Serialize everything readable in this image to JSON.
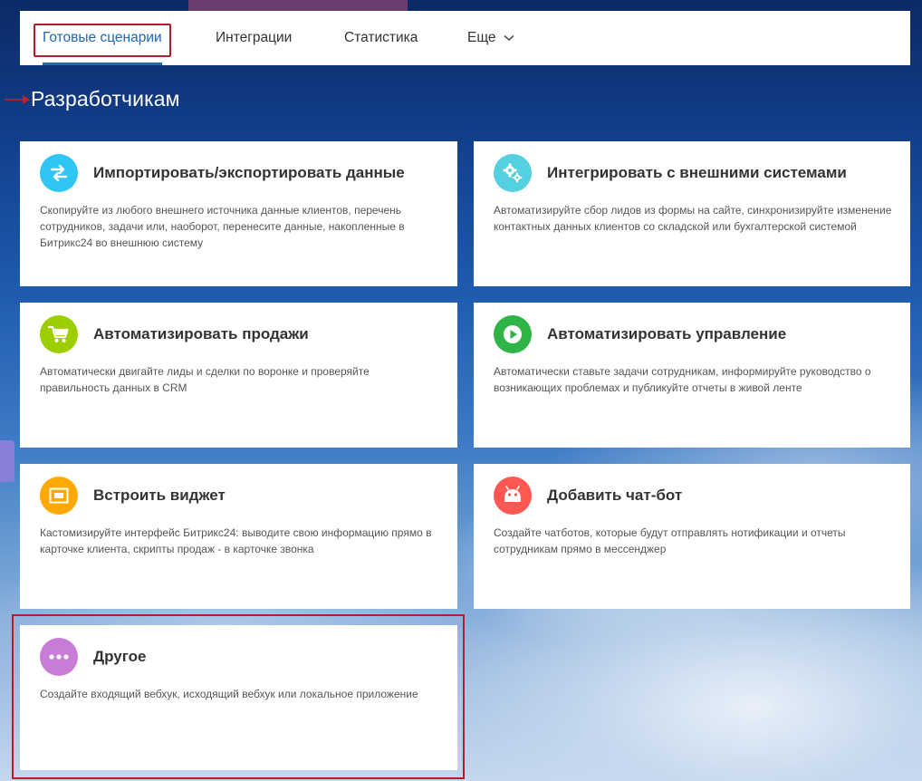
{
  "nav": {
    "tabs": [
      {
        "label": "Готовые сценарии",
        "active": true
      },
      {
        "label": "Интеграции",
        "active": false
      },
      {
        "label": "Статистика",
        "active": false
      },
      {
        "label": "Еще",
        "active": false
      }
    ]
  },
  "section": {
    "title": "Разработчикам"
  },
  "cards": [
    {
      "title": "Импортировать/экспортировать данные",
      "description": "Скопируйте из любого внешнего источника данные клиентов, перечень сотрудников, задачи или, наоборот, перенесите данные, накопленные в Битрикс24 во внешнюю систему",
      "icon": "exchange-arrows-icon",
      "color": "#2fc6f6"
    },
    {
      "title": "Интегрировать с внешними системами",
      "description": "Автоматизируйте сбор лидов из формы на сайте, синхронизируйте изменение контактных данных клиентов со складской или бухгалтерской системой",
      "icon": "gears-icon",
      "color": "#55d0e0"
    },
    {
      "title": "Автоматизировать продажи",
      "description": "Автоматически двигайте лиды и сделки по воронке и проверяйте правильность данных в CRM",
      "icon": "cart-icon",
      "color": "#9dcf00"
    },
    {
      "title": "Автоматизировать управление",
      "description": "Автоматически ставьте задачи сотрудникам, информируйте руководство о возникающих проблемах и публикуйте отчеты в живой ленте",
      "icon": "play-icon",
      "color": "#2fb446"
    },
    {
      "title": "Встроить виджет",
      "description": "Кастомизируйте интерфейс Битрикс24: выводите свою информацию прямо в карточке клиента, скрипты продаж - в карточке звонка",
      "icon": "widget-icon",
      "color": "#ffa900"
    },
    {
      "title": "Добавить чат-бот",
      "description": "Создайте чатботов, которые будут отправлять нотификации и отчеты сотрудникам прямо в мессенджер",
      "icon": "robot-icon",
      "color": "#ff5752"
    },
    {
      "title": "Другое",
      "description": "Создайте входящий вебхук, исходящий вебхук или локальное приложение",
      "icon": "more-dots-icon",
      "color": "#c77dd6"
    }
  ],
  "colors": {
    "accent": "#2067b0",
    "highlight": "#b0202a"
  }
}
